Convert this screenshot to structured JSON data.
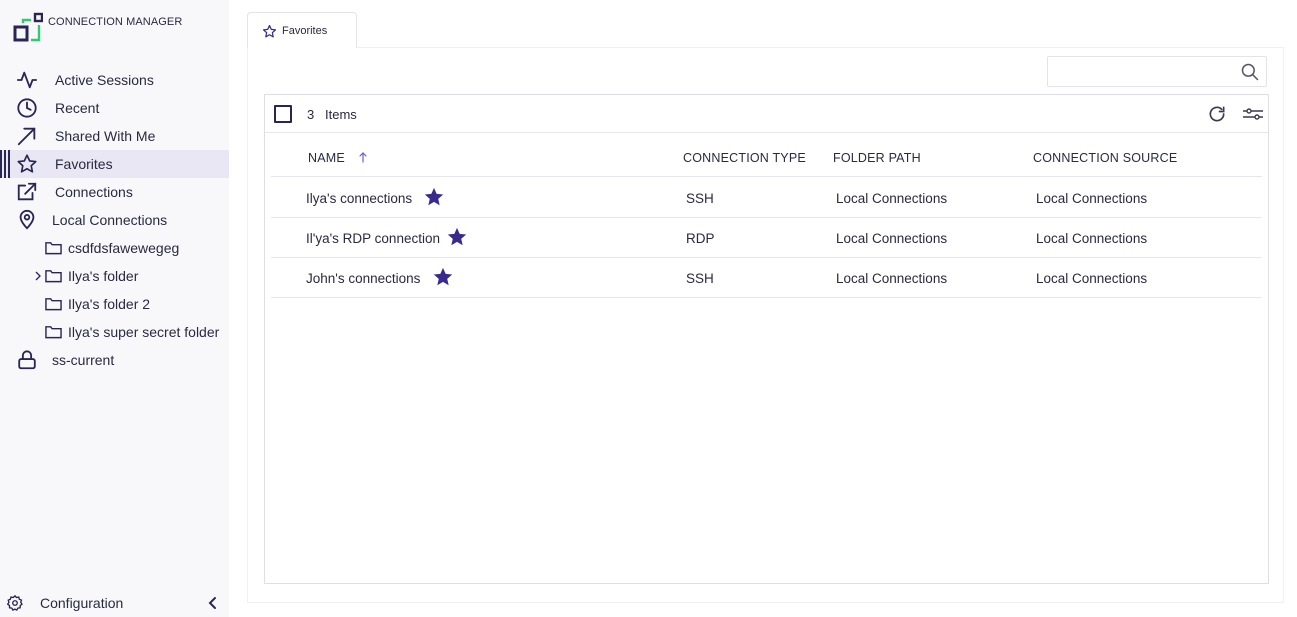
{
  "app": {
    "title": "CONNECTION MANAGER",
    "accent_color": "#3a2a8c",
    "brand_green": "#2ecc71"
  },
  "sidebar": {
    "items": [
      {
        "label": "Active Sessions",
        "icon": "activity-icon"
      },
      {
        "label": "Recent",
        "icon": "clock-icon"
      },
      {
        "label": "Shared With Me",
        "icon": "arrow-up-right-icon"
      },
      {
        "label": "Favorites",
        "icon": "star-icon",
        "active": true
      },
      {
        "label": "Connections",
        "icon": "external-link-icon"
      },
      {
        "label": "Local Connections",
        "icon": "location-pin-icon"
      }
    ],
    "folders": [
      {
        "label": "csdfdsfawewegeg",
        "icon": "folder-icon"
      },
      {
        "label": "Ilya's folder",
        "icon": "folder-icon",
        "expandable": true
      },
      {
        "label": "Ilya's folder 2",
        "icon": "folder-icon"
      },
      {
        "label": "Ilya's super secret folder",
        "icon": "folder-icon"
      }
    ],
    "vault": {
      "label": "ss-current",
      "icon": "lock-icon"
    },
    "footer": {
      "label": "Configuration",
      "icon": "gear-icon"
    }
  },
  "tabs": [
    {
      "label": "Favorites",
      "icon": "star-outline-icon"
    }
  ],
  "search": {
    "placeholder": ""
  },
  "grid": {
    "count": "3",
    "items_label": "Items",
    "columns": [
      "NAME",
      "CONNECTION TYPE",
      "FOLDER PATH",
      "CONNECTION SOURCE"
    ],
    "sort": {
      "column": "NAME",
      "direction": "ascending"
    },
    "rows": [
      {
        "name": "Ilya's connections",
        "type": "SSH",
        "folder": "Local Connections",
        "source": "Local Connections",
        "favorite": true
      },
      {
        "name": "Il'ya's RDP connection",
        "type": "RDP",
        "folder": "Local Connections",
        "source": "Local Connections",
        "favorite": true
      },
      {
        "name": "John's connections",
        "type": "SSH",
        "folder": "Local Connections",
        "source": "Local Connections",
        "favorite": true
      }
    ]
  }
}
